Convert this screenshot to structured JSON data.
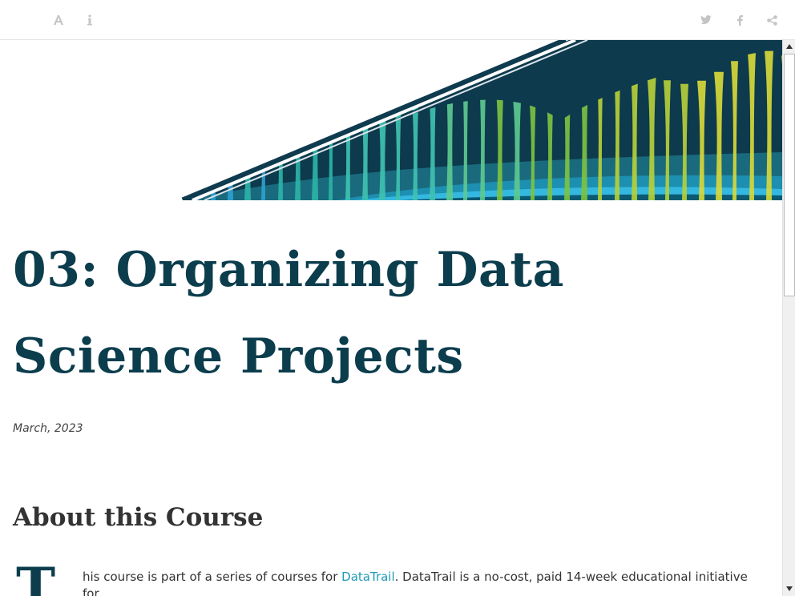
{
  "toolbar": {
    "left_icons": [
      "font-size-icon",
      "info-icon"
    ],
    "right_icons": [
      "twitter-icon",
      "facebook-icon",
      "share-icon"
    ]
  },
  "page": {
    "title": "03: Organizing Data Science Projects",
    "date": "March, 2023"
  },
  "about": {
    "heading": "About this Course",
    "dropcap": "T",
    "intro_before_link": "his course is part of a series of courses for ",
    "link_text": "DataTrail",
    "intro_after_link": ". DataTrail is a no-cost, paid 14-week educational initiative for"
  },
  "colors": {
    "title": "#0b3d4d",
    "link": "#1f9ab8",
    "banner_dark": "#0d3a4c",
    "banner_teal": "#2bb3a6",
    "banner_green": "#7cc242"
  }
}
